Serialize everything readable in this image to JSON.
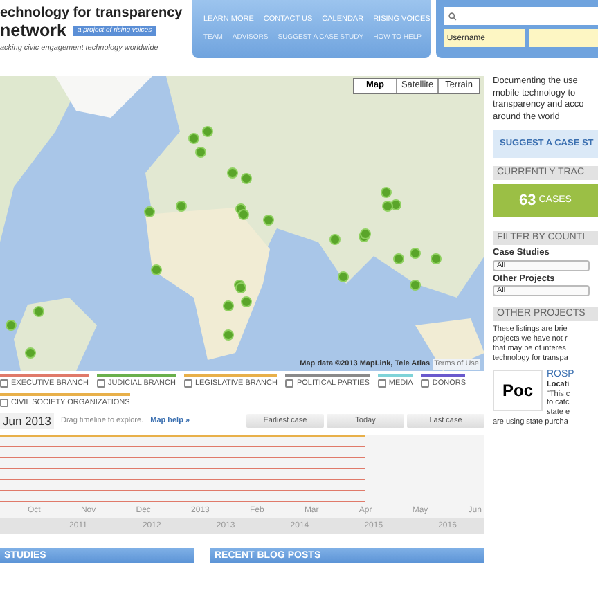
{
  "header": {
    "logo_line1": "echnology for transparency",
    "logo_line2": "network",
    "badge": "a project of rising voices",
    "tagline": "acking civic engagement technology worldwide"
  },
  "nav": {
    "primary": [
      "LEARN MORE",
      "CONTACT US",
      "CALENDAR",
      "RISING VOICES"
    ],
    "secondary": [
      "TEAM",
      "ADVISORS",
      "SUGGEST A CASE STUDY",
      "HOW TO HELP"
    ]
  },
  "login": {
    "username_placeholder": "Username"
  },
  "map": {
    "types": [
      {
        "label": "Map",
        "selected": true
      },
      {
        "label": "Satellite",
        "selected": false
      },
      {
        "label": "Terrain",
        "selected": false
      }
    ],
    "attribution": "Map data ©2013 MapLink, Tele Atlas",
    "terms": "Terms of Use"
  },
  "sectors": [
    {
      "label": "EXECUTIVE BRANCH",
      "checked": false,
      "color": "#e07a6a"
    },
    {
      "label": "JUDICIAL BRANCH",
      "checked": false,
      "color": "#6ab04c"
    },
    {
      "label": "LEGISLATIVE BRANCH",
      "checked": false,
      "color": "#e8b04a"
    },
    {
      "label": "POLITICAL PARTIES",
      "checked": false,
      "color": "#8a8a8a"
    },
    {
      "label": "MEDIA",
      "checked": false,
      "color": "#7fd3d8"
    },
    {
      "label": "DONORS",
      "checked": false,
      "color": "#6a5acd"
    },
    {
      "label": "CIVIL SOCIETY ORGANIZATIONS",
      "checked": false,
      "color": "#e8b04a"
    }
  ],
  "timeline": {
    "date": "Jun 2013",
    "hint": "Drag timeline to explore.",
    "help_link": "Map help »",
    "buttons": [
      "Earliest case",
      "Today",
      "Last case"
    ],
    "months": [
      "Oct",
      "Nov",
      "Dec",
      "2013",
      "Feb",
      "Mar",
      "Apr",
      "May",
      "Jun"
    ],
    "years": [
      "2011",
      "2012",
      "2013",
      "2014",
      "2015",
      "2016"
    ]
  },
  "sections": [
    "STUDIES",
    "RECENT BLOG POSTS"
  ],
  "sidebar": {
    "intro": [
      "Documenting the use",
      "mobile technology to",
      "transparency and acco",
      "around the world"
    ],
    "suggest_button": "SUGGEST A CASE ST",
    "tracking_heading": "CURRENTLY TRAC",
    "case_count": "63",
    "case_unit": "CASES",
    "filter_heading": "FILTER BY COUNTI",
    "filters": [
      {
        "label": "Case Studies",
        "value": "All"
      },
      {
        "label": "Other Projects",
        "value": "All"
      }
    ],
    "other_heading": "OTHER PROJECTS",
    "other_intro": [
      "These listings are brie",
      "projects we have not r",
      "that may be of interes",
      "technology for transpa"
    ],
    "project": {
      "logo_text": "Poc",
      "title": "ROSP",
      "location": "Locati",
      "excerpt": [
        "\"This c",
        "to catc",
        "state e"
      ],
      "tail": "are using state purcha"
    }
  }
}
